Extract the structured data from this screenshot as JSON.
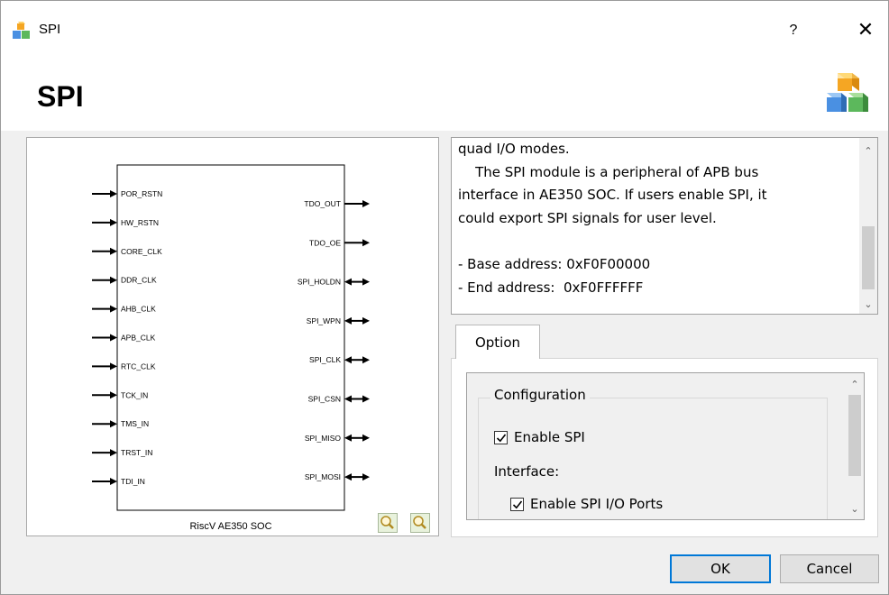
{
  "window": {
    "title": "SPI",
    "help_label": "?",
    "close_label": "✕"
  },
  "header": {
    "title": "SPI"
  },
  "diagram": {
    "caption": "RiscV AE350 SOC",
    "inputs": [
      "POR_RSTN",
      "HW_RSTN",
      "CORE_CLK",
      "DDR_CLK",
      "AHB_CLK",
      "APB_CLK",
      "RTC_CLK",
      "TCK_IN",
      "TMS_IN",
      "TRST_IN",
      "TDI_IN"
    ],
    "outputs": [
      {
        "name": "TDO_OUT",
        "dir": "out"
      },
      {
        "name": "TDO_OE",
        "dir": "out"
      },
      {
        "name": "SPI_HOLDN",
        "dir": "bi"
      },
      {
        "name": "SPI_WPN",
        "dir": "bi"
      },
      {
        "name": "SPI_CLK",
        "dir": "bi"
      },
      {
        "name": "SPI_CSN",
        "dir": "bi"
      },
      {
        "name": "SPI_MISO",
        "dir": "bi"
      },
      {
        "name": "SPI_MOSI",
        "dir": "bi"
      }
    ]
  },
  "description": {
    "lines": [
      "quad I/O modes.",
      "    The SPI module is a peripheral of APB bus",
      "interface in AE350 SOC. If users enable SPI, it",
      "could export SPI signals for user level.",
      "",
      "- Base address: 0xF0F00000",
      "- End address:  0xF0FFFFFF"
    ]
  },
  "options": {
    "tab_label": "Option",
    "group_title": "Configuration",
    "enable_spi": {
      "label": "Enable SPI",
      "checked": true
    },
    "interface_label": "Interface:",
    "enable_ports": {
      "label": "Enable SPI I/O Ports",
      "checked": true
    }
  },
  "buttons": {
    "ok": "OK",
    "cancel": "Cancel"
  },
  "colors": {
    "accent": "#0078d7",
    "cube_orange": "#f5a623",
    "cube_green": "#5cb85c",
    "cube_blue": "#4a90e2"
  }
}
